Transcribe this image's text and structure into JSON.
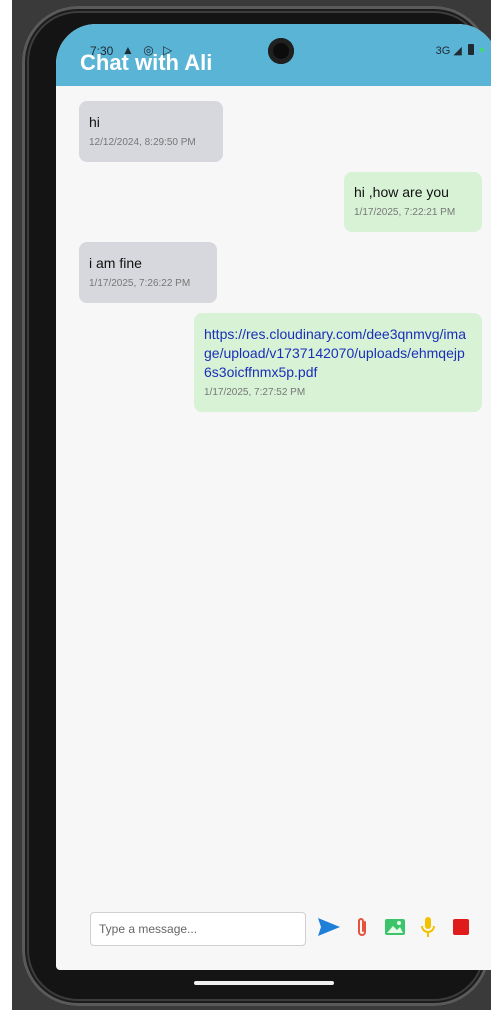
{
  "status_bar": {
    "time": "7:30",
    "left_icons": "▲ ◎ ▷",
    "network": "3G",
    "signal_glyph": "◢"
  },
  "header": {
    "title": "Chat with Ali"
  },
  "messages": [
    {
      "direction": "received",
      "text": "hi",
      "timestamp": "12/12/2024, 8:29:50 PM"
    },
    {
      "direction": "sent",
      "text": "hi ,how are you",
      "timestamp": "1/17/2025, 7:22:21 PM"
    },
    {
      "direction": "received",
      "text": "i am fine",
      "timestamp": "1/17/2025, 7:26:22 PM"
    },
    {
      "direction": "sent",
      "text": "https://res.cloudinary.com/dee3qnmvg/image/upload/v1737142070/uploads/ehmqejp6s3oicffnmx5p.pdf",
      "timestamp": "1/17/2025, 7:27:52 PM"
    }
  ],
  "composer": {
    "placeholder": "Type a message...",
    "value": "",
    "send_icon": "send-icon",
    "attach_icon": "paperclip-icon",
    "image_icon": "image-icon",
    "mic_icon": "microphone-icon",
    "stop_icon": "stop-icon"
  },
  "colors": {
    "appbar": "#5ab4d6",
    "received_bubble": "#d7d8dd",
    "sent_bubble": "#d8f2d6",
    "link": "#1a2fb8",
    "send": "#1e7fd8",
    "attach": "#e5533d",
    "image": "#3cc46a",
    "mic": "#f2c200",
    "stop": "#e01b1b"
  }
}
